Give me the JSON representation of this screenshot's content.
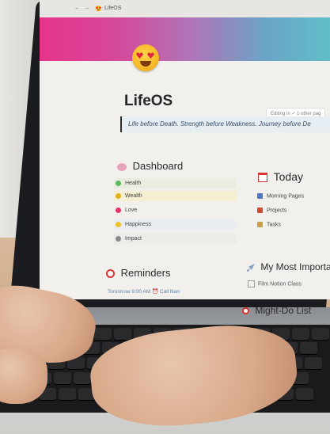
{
  "browser": {
    "tab_title": "LifeOS"
  },
  "page": {
    "title": "LifeOS",
    "editing_notice": "Editing in ✓ 1 other pag",
    "quote": "Life before Death. Strength before Weakness. Journey before De"
  },
  "dashboard": {
    "heading": "Dashboard",
    "items": [
      {
        "label": "Health",
        "dot_color": "#5cb85c",
        "row_bg": "#e9ecdf"
      },
      {
        "label": "Wealth",
        "dot_color": "#e0b21c",
        "row_bg": "#f4efd3"
      },
      {
        "label": "Love",
        "dot_color": "#e2336d",
        "row_bg": "#f1f0ed"
      },
      {
        "label": "Happiness",
        "dot_color": "#f0bf2b",
        "row_bg": "#e9edf2"
      },
      {
        "label": "Impact",
        "dot_color": "#8a8a8a",
        "row_bg": "#ecebe8"
      }
    ]
  },
  "today": {
    "heading": "Today",
    "items": [
      {
        "label": "Morning Pages",
        "icon_color": "#4a77c7"
      },
      {
        "label": "Projects",
        "icon_color": "#d24a2e"
      },
      {
        "label": "Tasks",
        "icon_color": "#c7a04a"
      }
    ]
  },
  "reminders": {
    "heading": "Reminders",
    "first_item": "Tomorrow 9:00 AM ⏰ Call Nan"
  },
  "important": {
    "heading": "My Most Importa",
    "first_item": "Film Notion Class"
  },
  "might_do": {
    "heading": "Might-Do List"
  },
  "colors": {
    "cover_start": "#e5348a",
    "cover_end": "#5fc2c9",
    "quote_bg": "#e6eef3",
    "text": "#262626"
  }
}
